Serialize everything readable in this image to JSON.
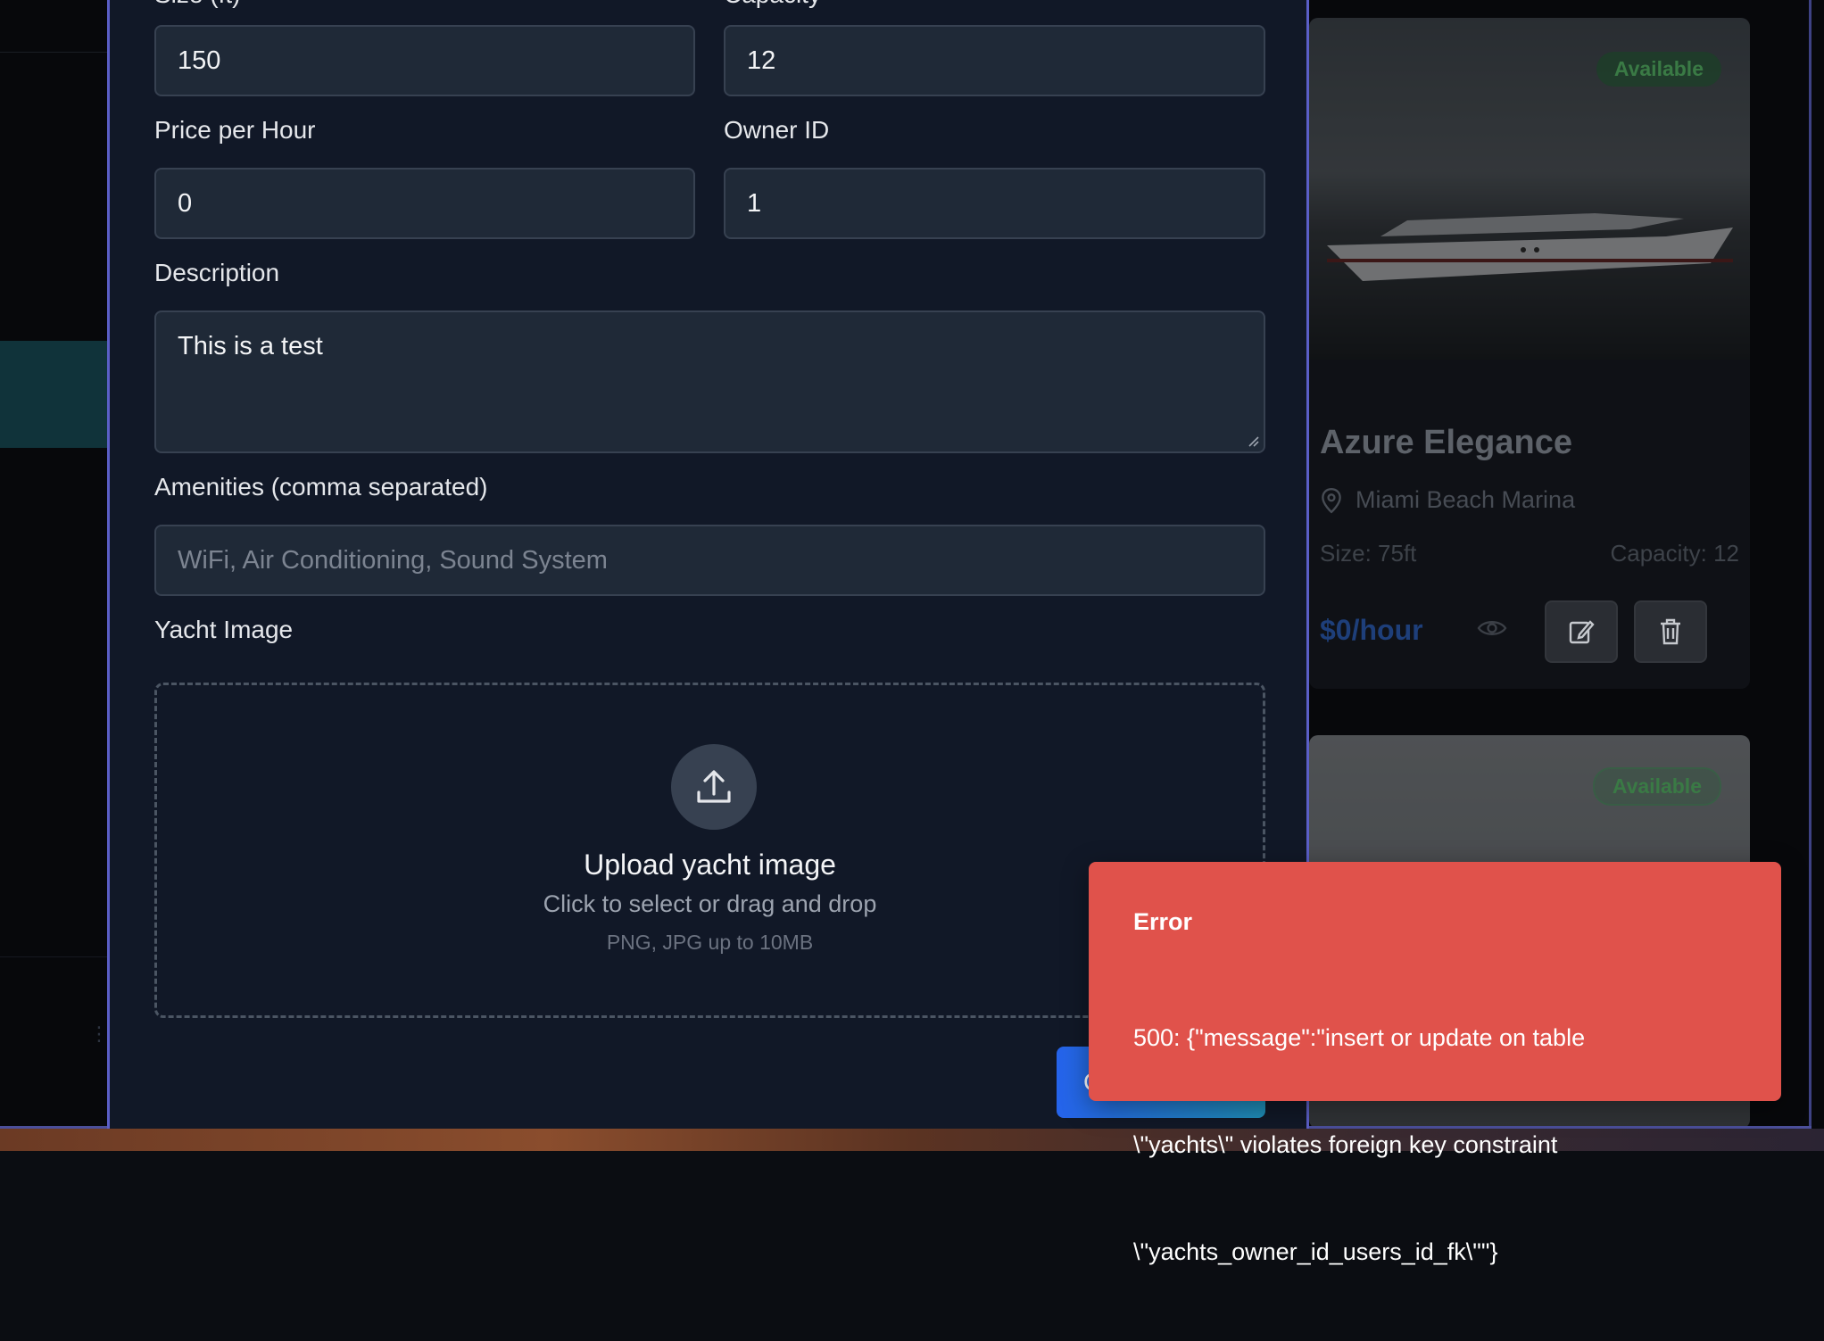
{
  "form": {
    "size_label": "Size (ft)",
    "size_value": "150",
    "capacity_label": "Capacity",
    "capacity_value": "12",
    "price_label": "Price per Hour",
    "price_value": "0",
    "owner_label": "Owner ID",
    "owner_value": "1",
    "description_label": "Description",
    "description_value": "This is a test",
    "amenities_label": "Amenities (comma separated)",
    "amenities_placeholder": "WiFi, Air Conditioning, Sound System",
    "image_label": "Yacht Image",
    "upload_title": "Upload yacht image",
    "upload_subtitle": "Click to select or drag and drop",
    "upload_hint": "PNG, JPG up to 10MB",
    "submit_label": "C"
  },
  "background_card": {
    "status": "Available",
    "name": "Azure Elegance",
    "location": "Miami Beach Marina",
    "size": "Size: 75ft",
    "capacity": "Capacity: 12",
    "price": "$0/hour",
    "second_status": "Available"
  },
  "toast": {
    "title": "Error",
    "message": "500: {\"message\":\"insert or update on table \\\"yachts\\\" violates foreign key constraint \\\"yachts_owner_id_users_id_fk\\\"\"}",
    "message_lines": [
      "500: {\"message\":\"insert or update on table",
      "\\\"yachts\\\" violates foreign key constraint",
      "\\\"yachts_owner_id_users_id_fk\\\"\"}"
    ]
  },
  "colors": {
    "modal_bg": "#111827",
    "field_bg": "#1f2937",
    "toast_bg": "#e0524b",
    "accent_border": "#5b5fc7",
    "button_gradient_start": "#2563eb",
    "button_gradient_end": "#1f8fb8"
  },
  "icons": {
    "upload": "upload-icon",
    "location": "map-pin-icon",
    "view": "eye-icon",
    "edit": "edit-icon",
    "delete": "trash-icon",
    "resize": "resize-grip-icon"
  }
}
